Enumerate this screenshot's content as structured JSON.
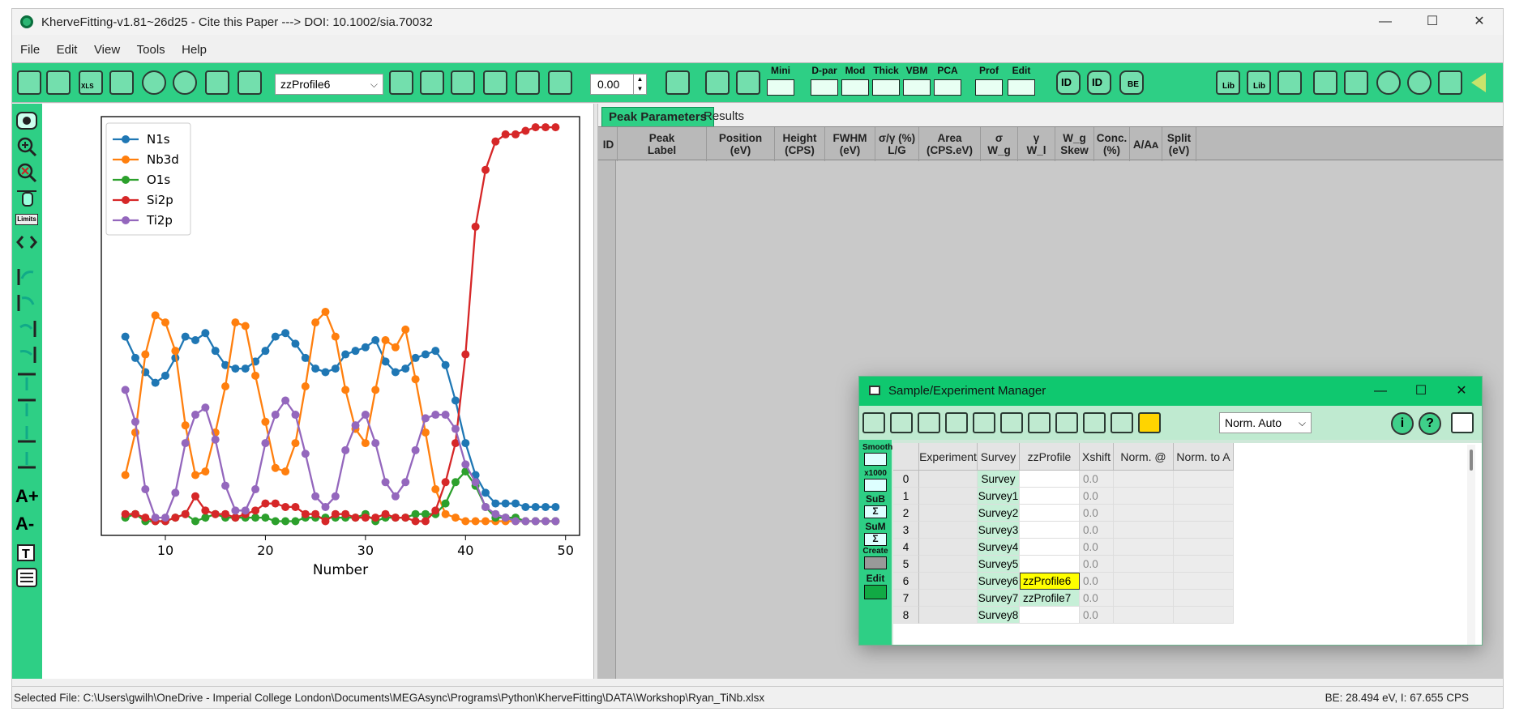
{
  "window": {
    "title": "KherveFitting-v1.81~26d25 - Cite this Paper ---> DOI: 10.1002/sia.70032",
    "min_glyph": "—",
    "max_glyph": "☐",
    "close_glyph": "✕"
  },
  "menu": [
    "File",
    "Edit",
    "View",
    "Tools",
    "Help"
  ],
  "toolbar": {
    "profile_select": "zzProfile6",
    "numeric_value": "0.00",
    "text_buttons": [
      "Mini",
      "D-par",
      "Mod",
      "Thick",
      "VBM",
      "PCA",
      "Prof",
      "Edit"
    ],
    "lib_labels": [
      "Lib",
      "Lib"
    ],
    "id_labels": [
      "ID",
      "ID"
    ],
    "be_label": "BE",
    "xls_label": "XLS"
  },
  "left_tools": {
    "limits_label": "Limits",
    "font_up": "A+",
    "font_down": "A-"
  },
  "chart_data": {
    "type": "line",
    "xlabel": "Number",
    "ylabel": "",
    "xlim": [
      3.6,
      51.4
    ],
    "ylim": [
      0,
      100
    ],
    "xticks": [
      10,
      20,
      30,
      40,
      50
    ],
    "legend_placement": "top-left",
    "x": [
      6,
      7,
      8,
      9,
      10,
      11,
      12,
      13,
      14,
      15,
      16,
      17,
      18,
      19,
      20,
      21,
      22,
      23,
      24,
      25,
      26,
      27,
      28,
      29,
      30,
      31,
      32,
      33,
      34,
      35,
      36,
      37,
      38,
      39,
      40,
      41,
      42,
      43,
      44,
      45,
      46,
      47,
      48,
      49
    ],
    "series": [
      {
        "name": "N1s",
        "color": "#1f77b4",
        "values": [
          53,
          47,
          43,
          40,
          42,
          47,
          53,
          52,
          54,
          49,
          45,
          44,
          44,
          46,
          49,
          53,
          54,
          51,
          47,
          44,
          43,
          44,
          48,
          49,
          50,
          52,
          46,
          43,
          44,
          47,
          48,
          49,
          45,
          35,
          23,
          14,
          9,
          6,
          6,
          6,
          5,
          5,
          5,
          5
        ]
      },
      {
        "name": "Nb3d",
        "color": "#ff7f0e",
        "values": [
          14,
          26,
          48,
          59,
          57,
          49,
          28,
          14,
          15,
          26,
          39,
          57,
          56,
          42,
          29,
          16,
          15,
          23,
          39,
          57,
          60,
          53,
          38,
          27,
          23,
          38,
          52,
          50,
          55,
          41,
          26,
          10,
          3,
          2,
          1,
          1,
          1,
          1,
          1,
          1,
          1,
          1,
          1,
          1
        ]
      },
      {
        "name": "O1s",
        "color": "#2ca02c",
        "values": [
          2,
          3,
          1,
          1,
          1,
          2,
          3,
          1,
          2,
          3,
          2,
          2,
          2,
          2,
          2,
          1,
          1,
          1,
          2,
          2,
          2,
          2,
          2,
          2,
          3,
          1,
          2,
          2,
          2,
          3,
          3,
          3,
          6,
          12,
          15,
          11,
          5,
          2,
          2,
          2,
          1,
          1,
          1,
          1
        ]
      },
      {
        "name": "Si2p",
        "color": "#d62728",
        "values": [
          3,
          3,
          2,
          1,
          1,
          2,
          3,
          8,
          4,
          3,
          3,
          2,
          3,
          4,
          6,
          6,
          5,
          5,
          3,
          3,
          1,
          3,
          3,
          2,
          2,
          2,
          3,
          2,
          2,
          1,
          1,
          4,
          12,
          23,
          48,
          84,
          100,
          108,
          110,
          110,
          111,
          112,
          112,
          112
        ]
      },
      {
        "name": "Ti2p",
        "color": "#9467bd",
        "values": [
          38,
          29,
          10,
          2,
          2,
          9,
          23,
          31,
          33,
          24,
          11,
          4,
          4,
          10,
          23,
          31,
          35,
          31,
          20,
          8,
          5,
          8,
          21,
          28,
          31,
          23,
          12,
          8,
          12,
          21,
          30,
          31,
          31,
          27,
          17,
          12,
          5,
          3,
          2,
          1,
          1,
          1,
          1,
          1
        ]
      }
    ]
  },
  "right_panel": {
    "tabs": [
      "Peak Parameters",
      "Results"
    ],
    "columns": [
      "ID",
      "Peak\nLabel",
      "Position\n(eV)",
      "Height\n(CPS)",
      "FWHM\n(eV)",
      "σ/γ (%)\nL/G",
      "Area\n(CPS.eV)",
      "σ\nW_g",
      "γ\nW_l",
      "W_g\nSkew",
      "Conc.\n(%)",
      "A/Aᴀ",
      "Split\n(eV)"
    ]
  },
  "manager": {
    "title": "Sample/Experiment Manager",
    "norm_select": "Norm. Auto",
    "side_labels": [
      "Smooth",
      "x1000",
      "SuB",
      "SuM",
      "Create",
      "Edit"
    ],
    "side_sigma": "Σ",
    "info_icon": "i",
    "help_icon": "?",
    "columns": [
      "Experiment",
      "Survey",
      "zzProfile",
      "Xshift",
      "Norm. @ BE",
      "Norm. to A"
    ],
    "rows": [
      {
        "index": "0",
        "survey": "Survey",
        "zzprofile": "",
        "xshift": "0.0"
      },
      {
        "index": "1",
        "survey": "Survey1",
        "zzprofile": "",
        "xshift": "0.0"
      },
      {
        "index": "2",
        "survey": "Survey2",
        "zzprofile": "",
        "xshift": "0.0"
      },
      {
        "index": "3",
        "survey": "Survey3",
        "zzprofile": "",
        "xshift": "0.0"
      },
      {
        "index": "4",
        "survey": "Survey4",
        "zzprofile": "",
        "xshift": "0.0"
      },
      {
        "index": "5",
        "survey": "Survey5",
        "zzprofile": "",
        "xshift": "0.0"
      },
      {
        "index": "6",
        "survey": "Survey6",
        "zzprofile": "zzProfile6",
        "xshift": "0.0"
      },
      {
        "index": "7",
        "survey": "Survey7",
        "zzprofile": "zzProfile7",
        "xshift": "0.0"
      },
      {
        "index": "8",
        "survey": "Survey8",
        "zzprofile": "",
        "xshift": "0.0"
      }
    ]
  },
  "status": {
    "left": "Selected File: C:\\Users\\gwilh\\OneDrive - Imperial College London\\Documents\\MEGAsync\\Programs\\Python\\KherveFitting\\DATA\\Workshop\\Ryan_TiNb.xlsx",
    "right": "BE: 28.494 eV, I: 67.655 CPS"
  }
}
